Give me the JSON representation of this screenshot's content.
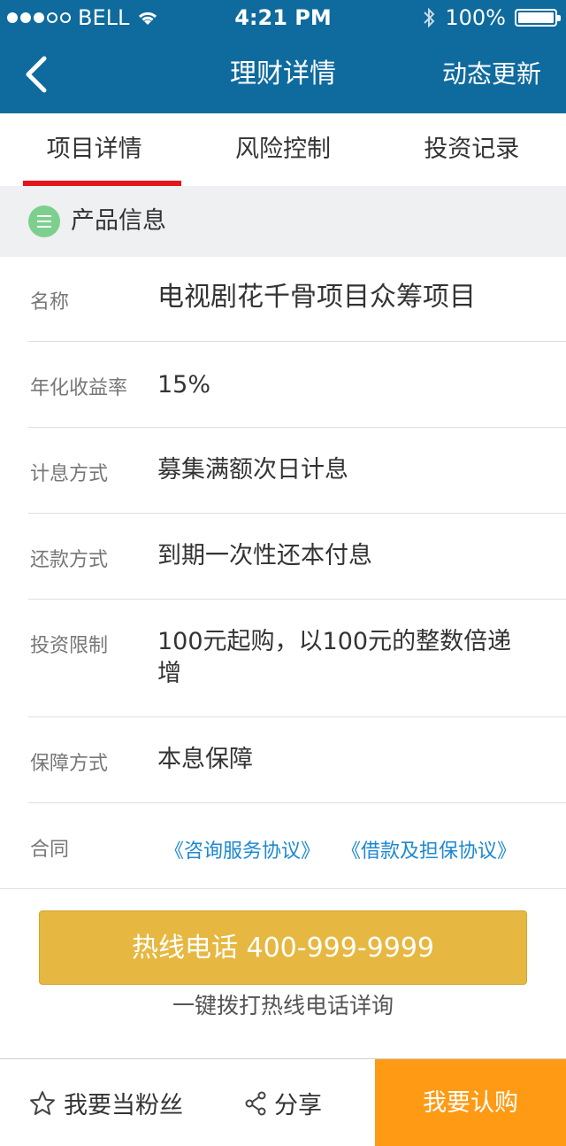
{
  "status_bar": {
    "carrier": "BELL",
    "time": "4:21 PM",
    "battery": "100%"
  },
  "navbar": {
    "title": "理财详情",
    "right_action": "动态更新"
  },
  "tabs": [
    {
      "label": "项目详情",
      "active": true
    },
    {
      "label": "风险控制",
      "active": false
    },
    {
      "label": "投资记录",
      "active": false
    }
  ],
  "section": {
    "title": "产品信息"
  },
  "details": [
    {
      "label": "名称",
      "value": "电视剧花千骨项目众筹项目"
    },
    {
      "label": "年化收益率",
      "value": "15%"
    },
    {
      "label": "计息方式",
      "value": "募集满额次日计息"
    },
    {
      "label": "还款方式",
      "value": "到期一次性还本付息"
    },
    {
      "label": "投资限制",
      "value": "100元起购，以100元的整数倍递增"
    },
    {
      "label": "保障方式",
      "value": "本息保障"
    }
  ],
  "contract": {
    "label": "合同",
    "links": [
      "《咨询服务协议》",
      "《借款及担保协议》"
    ]
  },
  "hotline": {
    "button": "热线电话 400-999-9999",
    "caption": "一键拨打热线电话详询"
  },
  "bottom_bar": {
    "favorite": "我要当粉丝",
    "share": "分享",
    "buy": "我要认购"
  },
  "colors": {
    "header": "#0f6b9d",
    "tab_indicator": "#e8141b",
    "hotline": "#e6b841",
    "buy": "#ff9a14",
    "link": "#1c88d2",
    "section_icon": "#7dcf8e"
  }
}
